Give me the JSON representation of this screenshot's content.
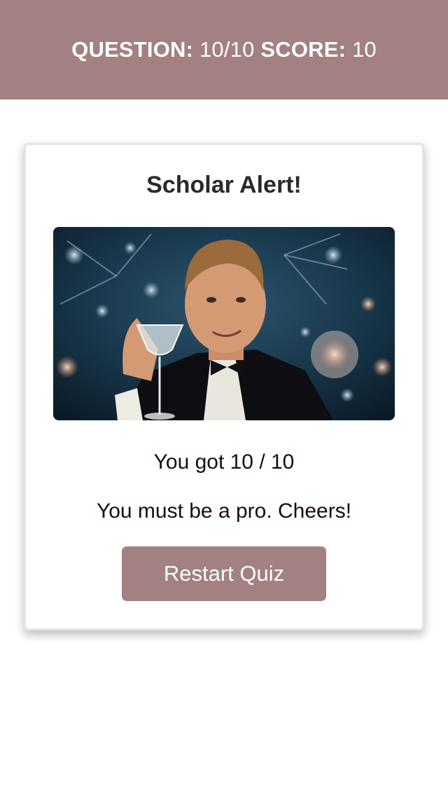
{
  "header": {
    "question_label": "QUESTION:",
    "question_value": "10/10",
    "score_label": "SCORE:",
    "score_value": "10"
  },
  "result_card": {
    "title": "Scholar Alert!",
    "image_icon": "celebration-toast-image",
    "score_text": "You got 10 / 10",
    "message": "You must be a pro. Cheers!",
    "restart_label": "Restart Quiz"
  },
  "colors": {
    "accent": "#a38081",
    "text": "#1e0c0c",
    "title": "#2a2a2a",
    "background": "#ffffff"
  }
}
